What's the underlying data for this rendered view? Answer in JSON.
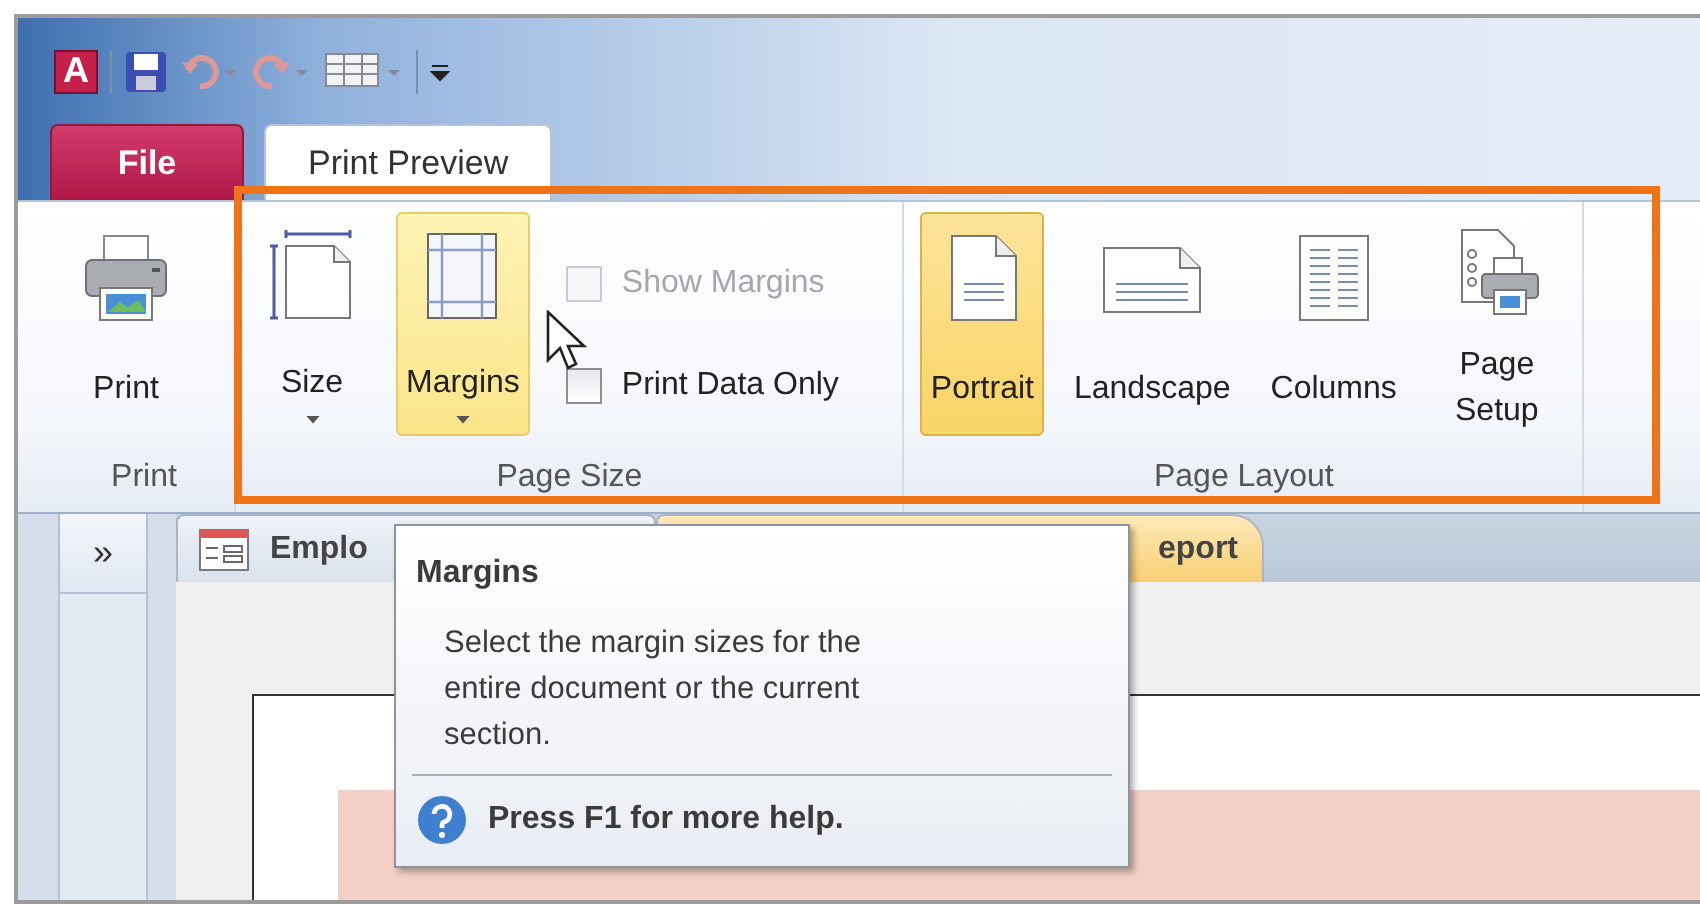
{
  "title_bar": {
    "app_logo": "A"
  },
  "tabs": [
    {
      "label": "File",
      "kind": "file",
      "selected": false
    },
    {
      "label": "Print Preview",
      "kind": "tab",
      "selected": true
    }
  ],
  "ribbon": {
    "groups": [
      {
        "label": "Print",
        "items": [
          {
            "kind": "large",
            "label": "Print",
            "dropdown": false,
            "selected": false,
            "hovered": false
          }
        ]
      },
      {
        "label": "Page Size",
        "items": [
          {
            "kind": "large",
            "label": "Size",
            "dropdown": true,
            "selected": false,
            "hovered": false
          },
          {
            "kind": "large",
            "label": "Margins",
            "dropdown": true,
            "selected": false,
            "hovered": true
          },
          {
            "kind": "checks",
            "checks": [
              {
                "label": "Show Margins",
                "checked": false,
                "disabled": true
              },
              {
                "label": "Print Data Only",
                "checked": false,
                "disabled": false
              }
            ]
          }
        ]
      },
      {
        "label": "Page Layout",
        "items": [
          {
            "kind": "large",
            "label": "Portrait",
            "dropdown": false,
            "selected": true,
            "hovered": false
          },
          {
            "kind": "large",
            "label": "Landscape",
            "dropdown": false,
            "selected": false,
            "hovered": false
          },
          {
            "kind": "large",
            "label": "Columns",
            "dropdown": false,
            "selected": false,
            "hovered": false
          },
          {
            "kind": "large",
            "label": "Page Setup",
            "dropdown": false,
            "selected": false,
            "hovered": false
          }
        ]
      }
    ]
  },
  "navigation_pane": {
    "toggle": "»"
  },
  "document_tabs": [
    {
      "label": "Emplo",
      "selected": false
    },
    {
      "label": "eport",
      "selected": true
    }
  ],
  "tooltip": {
    "title": "Margins",
    "description": "Select the margin sizes for the entire document or the current section.",
    "help": "Press F1 for more help."
  }
}
